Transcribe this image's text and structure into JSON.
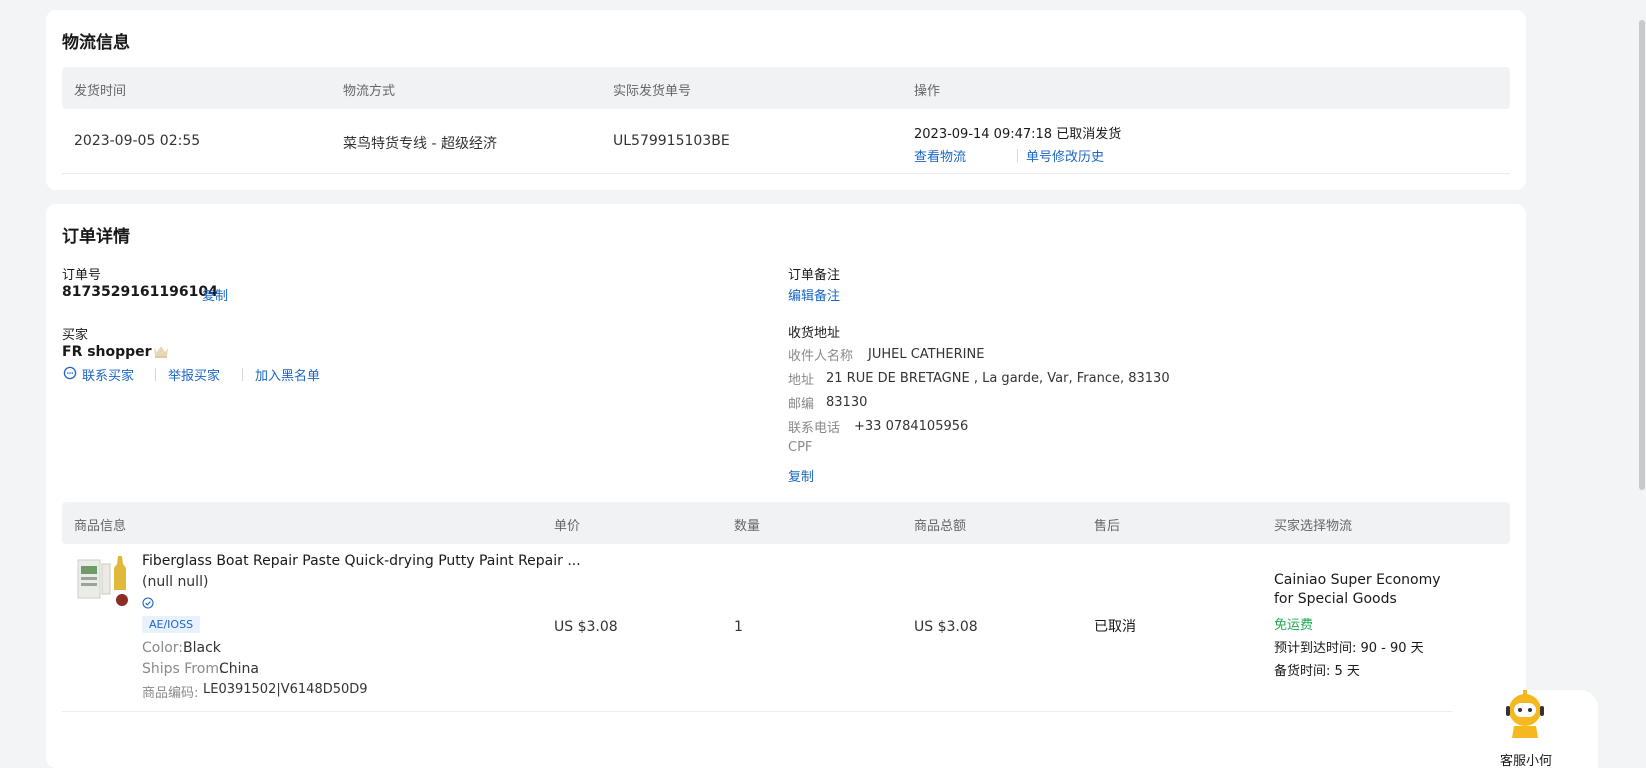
{
  "logistics": {
    "title": "物流信息",
    "columns": [
      "发货时间",
      "物流方式",
      "实际发货单号",
      "操作"
    ],
    "row": {
      "ship_time": "2023-09-05 02:55",
      "method": "菜鸟特货专线 - 超级经济",
      "tracking_no": "UL579915103BE",
      "op_status": "2023-09-14 09:47:18 已取消发货",
      "link_view": "查看物流",
      "link_history": "单号修改历史"
    }
  },
  "order": {
    "title": "订单详情",
    "order_no_label": "订单号",
    "order_no": "8173529161196104",
    "copy": "复制",
    "buyer_label": "买家",
    "buyer_name": "FR shopper",
    "contact_buyer": "联系买家",
    "report_buyer": "举报买家",
    "blacklist": "加入黑名单",
    "remark_label": "订单备注",
    "edit_remark": "编辑备注",
    "address_label": "收货地址",
    "recipient_label": "收件人名称",
    "recipient": "JUHEL CATHERINE",
    "addr_label": "地址",
    "addr": "21 RUE DE BRETAGNE , La garde, Var, France, 83130",
    "zip_label": "邮编",
    "zip": "83130",
    "phone_label": "联系电话",
    "phone": "+33 0784105956",
    "cpf_label": "CPF",
    "copy_address": "复制"
  },
  "products": {
    "columns": [
      "商品信息",
      "单价",
      "数量",
      "商品总额",
      "售后",
      "买家选择物流"
    ],
    "item": {
      "title": "Fiberglass Boat Repair Paste Quick-drying Putty Paint Repair ...",
      "variant": "(null null)",
      "tag": "AE/IOSS",
      "color_label": "Color:",
      "color": "Black",
      "ships_label": "Ships From:",
      "ships": "China",
      "sku_label": "商品编码:",
      "sku": "LE0391502|V6148D50D9",
      "unit_price": "US $3.08",
      "qty": "1",
      "total": "US $3.08",
      "after_sale": "已取消",
      "logistics_line1": "Cainiao Super Economy",
      "logistics_line2": "for Special Goods",
      "free_shipping": "免运费",
      "eta": "预计到达时间: 90 - 90 天",
      "prep": "备货时间: 5 天"
    }
  },
  "assistant": {
    "label": "客服小何"
  },
  "colors": {
    "link": "#1a66c7",
    "green": "#1fa84f",
    "header_bg": "#f1f2f4"
  }
}
